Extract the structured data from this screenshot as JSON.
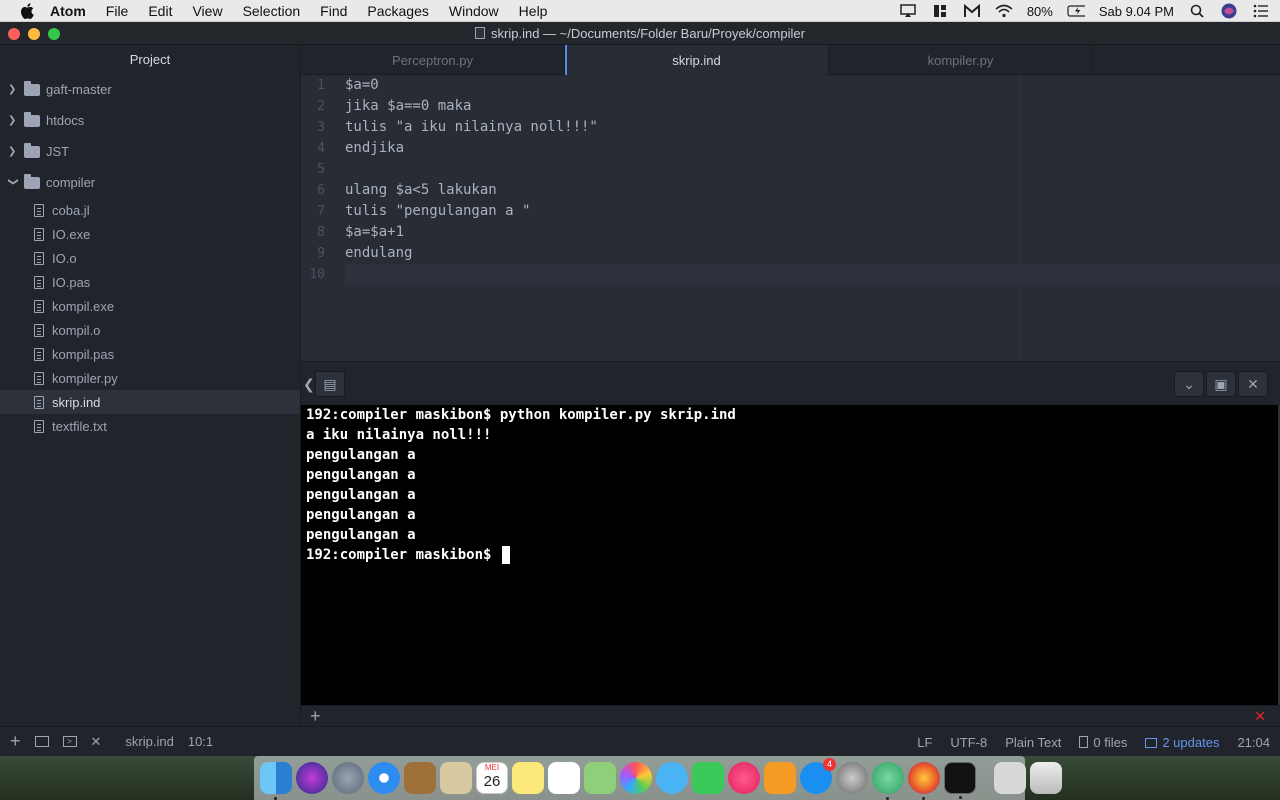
{
  "menubar": {
    "app_name": "Atom",
    "items": [
      "File",
      "Edit",
      "View",
      "Selection",
      "Find",
      "Packages",
      "Window",
      "Help"
    ],
    "battery": "80%",
    "clock": "Sab 9.04 PM"
  },
  "window": {
    "title": "skrip.ind — ~/Documents/Folder Baru/Proyek/compiler"
  },
  "sidebar": {
    "header": "Project",
    "folders": [
      {
        "name": "gaft-master",
        "expanded": false
      },
      {
        "name": "htdocs",
        "expanded": false
      },
      {
        "name": "JST",
        "expanded": false
      },
      {
        "name": "compiler",
        "expanded": true
      }
    ],
    "files": [
      "coba.jl",
      "IO.exe",
      "IO.o",
      "IO.pas",
      "kompil.exe",
      "kompil.o",
      "kompil.pas",
      "kompiler.py",
      "skrip.ind",
      "textfile.txt"
    ],
    "active_file": "skrip.ind"
  },
  "tabs": [
    {
      "label": "Perceptron.py",
      "active": false
    },
    {
      "label": "skrip.ind",
      "active": true
    },
    {
      "label": "kompiler.py",
      "active": false
    }
  ],
  "editor": {
    "line_numbers": [
      "1",
      "2",
      "3",
      "4",
      "5",
      "6",
      "7",
      "8",
      "9",
      "10"
    ],
    "lines": [
      "$a=0",
      "jika $a==0 maka",
      "tulis \"a iku nilainya noll!!!\"",
      "endjika",
      "",
      "ulang $a<5 lakukan",
      "tulis \"pengulangan a \"",
      "$a=$a+1",
      "endulang",
      ""
    ]
  },
  "terminal": {
    "lines": [
      "192:compiler maskibon$ python kompiler.py skrip.ind",
      "a iku nilainya noll!!!",
      "pengulangan a",
      "pengulangan a",
      "pengulangan a",
      "pengulangan a",
      "pengulangan a",
      "192:compiler maskibon$ "
    ]
  },
  "statusbar": {
    "file": "skrip.ind",
    "cursor_pos": "10:1",
    "line_ending": "LF",
    "encoding": "UTF-8",
    "grammar": "Plain Text",
    "git_files": "0 files",
    "updates": "2 updates",
    "time": "21:04"
  },
  "dock": {
    "calendar_month": "MEI",
    "calendar_day": "26",
    "app_store_badge": "4"
  },
  "colors": {
    "accent": "#568af2",
    "bg_editor": "#282c34",
    "bg_panel": "#21252b",
    "error": "#e06c75"
  }
}
